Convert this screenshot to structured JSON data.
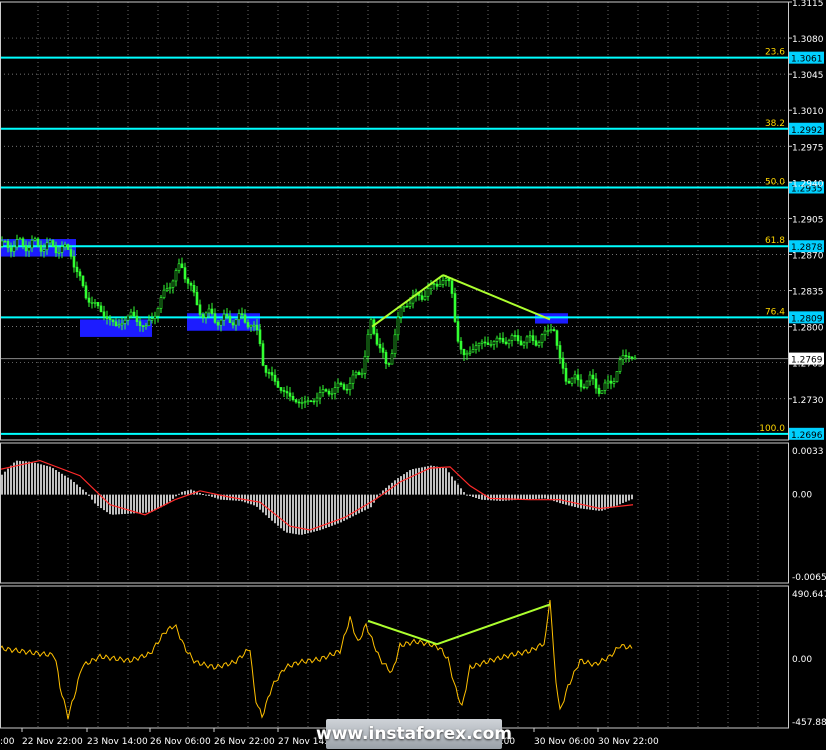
{
  "chart_data": [
    {
      "type": "candlestick",
      "panel": "price",
      "ylim": [
        1.269,
        1.3115
      ],
      "y_ticks": [
        "1.3115",
        "1.3080",
        "1.3045",
        "1.3010",
        "1.2975",
        "1.2940",
        "1.2905",
        "1.2870",
        "1.2835",
        "1.2800",
        "1.2765",
        "1.2730"
      ],
      "current_price": "1.2769",
      "fib_levels": [
        {
          "label": "23.6",
          "value": "1.3061"
        },
        {
          "label": "38.2",
          "value": "1.2992"
        },
        {
          "label": "50.0",
          "value": "1.2935"
        },
        {
          "label": "61.8",
          "value": "1.2878"
        },
        {
          "label": "76.4",
          "value": "1.2809"
        },
        {
          "label": "100.0",
          "value": "1.2696"
        }
      ],
      "zones": [
        {
          "from": 0,
          "to": 76,
          "price_top": 1.2885,
          "price_bottom": 1.2868
        },
        {
          "from": 80,
          "to": 152,
          "price_top": 1.2807,
          "price_bottom": 1.279
        },
        {
          "from": 187,
          "to": 260,
          "price_top": 1.2813,
          "price_bottom": 1.2796
        },
        {
          "from": 535,
          "to": 568,
          "price_top": 1.2813,
          "price_bottom": 1.2803
        }
      ],
      "price_path": [
        [
          0,
          1.2878
        ],
        [
          20,
          1.288
        ],
        [
          40,
          1.2879
        ],
        [
          60,
          1.2876
        ],
        [
          70,
          1.2872
        ],
        [
          75,
          1.2855
        ],
        [
          85,
          1.283
        ],
        [
          100,
          1.2815
        ],
        [
          115,
          1.28
        ],
        [
          130,
          1.2812
        ],
        [
          145,
          1.2798
        ],
        [
          160,
          1.2825
        ],
        [
          170,
          1.2845
        ],
        [
          180,
          1.2858
        ],
        [
          188,
          1.2845
        ],
        [
          195,
          1.282
        ],
        [
          205,
          1.2812
        ],
        [
          220,
          1.2806
        ],
        [
          240,
          1.2808
        ],
        [
          250,
          1.2803
        ],
        [
          258,
          1.279
        ],
        [
          263,
          1.276
        ],
        [
          275,
          1.2745
        ],
        [
          290,
          1.273
        ],
        [
          305,
          1.2725
        ],
        [
          320,
          1.2735
        ],
        [
          335,
          1.274
        ],
        [
          350,
          1.2745
        ],
        [
          362,
          1.2762
        ],
        [
          370,
          1.2802
        ],
        [
          378,
          1.2785
        ],
        [
          386,
          1.2755
        ],
        [
          395,
          1.28
        ],
        [
          405,
          1.2825
        ],
        [
          420,
          1.283
        ],
        [
          440,
          1.2845
        ],
        [
          450,
          1.2842
        ],
        [
          456,
          1.279
        ],
        [
          462,
          1.277
        ],
        [
          475,
          1.2782
        ],
        [
          490,
          1.2785
        ],
        [
          510,
          1.2788
        ],
        [
          530,
          1.2786
        ],
        [
          545,
          1.279
        ],
        [
          552,
          1.2808
        ],
        [
          558,
          1.2765
        ],
        [
          565,
          1.2752
        ],
        [
          578,
          1.2745
        ],
        [
          590,
          1.2748
        ],
        [
          600,
          1.2738
        ],
        [
          612,
          1.2748
        ],
        [
          620,
          1.2768
        ],
        [
          628,
          1.2773
        ],
        [
          634,
          1.2769
        ]
      ],
      "trendlines": [
        [
          [
            372,
            1.28
          ],
          [
            443,
            1.285
          ]
        ],
        [
          [
            443,
            1.285
          ],
          [
            550,
            1.2807
          ]
        ]
      ]
    },
    {
      "type": "histogram",
      "panel": "MACD",
      "ylim": [
        -0.00653,
        0.0033
      ],
      "y_ticks": [
        "0.0033",
        "0.00",
        "-0.00653"
      ],
      "hist_path": [
        [
          0,
          0.0015
        ],
        [
          15,
          0.0027
        ],
        [
          30,
          0.0026
        ],
        [
          50,
          0.0022
        ],
        [
          70,
          0.0012
        ],
        [
          85,
          0.0002
        ],
        [
          95,
          -0.0008
        ],
        [
          110,
          -0.0016
        ],
        [
          130,
          -0.0015
        ],
        [
          150,
          -0.0014
        ],
        [
          165,
          -0.0008
        ],
        [
          180,
          0.0002
        ],
        [
          190,
          0.0004
        ],
        [
          200,
          0.0001
        ],
        [
          220,
          -0.0004
        ],
        [
          240,
          -0.0005
        ],
        [
          255,
          -0.0009
        ],
        [
          270,
          -0.002
        ],
        [
          285,
          -0.003
        ],
        [
          300,
          -0.0032
        ],
        [
          320,
          -0.0028
        ],
        [
          340,
          -0.0022
        ],
        [
          355,
          -0.0016
        ],
        [
          370,
          -0.001
        ],
        [
          380,
          0.0002
        ],
        [
          395,
          0.0012
        ],
        [
          410,
          0.002
        ],
        [
          430,
          0.0023
        ],
        [
          445,
          0.0021
        ],
        [
          455,
          0.001
        ],
        [
          465,
          0.0
        ],
        [
          480,
          -0.0004
        ],
        [
          500,
          -0.0005
        ],
        [
          520,
          -0.0004
        ],
        [
          545,
          -0.0003
        ],
        [
          560,
          -0.0007
        ],
        [
          580,
          -0.0011
        ],
        [
          600,
          -0.0013
        ],
        [
          615,
          -0.0009
        ],
        [
          633,
          -0.0003
        ]
      ],
      "signal_path": [
        [
          0,
          0.002
        ],
        [
          40,
          0.0027
        ],
        [
          80,
          0.0015
        ],
        [
          110,
          -0.0008
        ],
        [
          145,
          -0.0016
        ],
        [
          175,
          -0.0004
        ],
        [
          200,
          0.0003
        ],
        [
          230,
          -0.0002
        ],
        [
          260,
          -0.0006
        ],
        [
          290,
          -0.0025
        ],
        [
          310,
          -0.0028
        ],
        [
          345,
          -0.0018
        ],
        [
          375,
          -0.0004
        ],
        [
          400,
          0.001
        ],
        [
          430,
          0.0021
        ],
        [
          450,
          0.0022
        ],
        [
          470,
          0.0007
        ],
        [
          490,
          -0.0003
        ],
        [
          530,
          -0.0004
        ],
        [
          560,
          -0.0004
        ],
        [
          600,
          -0.0011
        ],
        [
          633,
          -0.0008
        ]
      ]
    },
    {
      "type": "line",
      "panel": "CCI",
      "ylim": [
        -457.889,
        490.647
      ],
      "y_ticks": [
        "490.647",
        "0.00",
        "-457.889"
      ],
      "series_path": [
        [
          0,
          80
        ],
        [
          20,
          60
        ],
        [
          40,
          40
        ],
        [
          55,
          30
        ],
        [
          60,
          -200
        ],
        [
          68,
          -420
        ],
        [
          75,
          -250
        ],
        [
          82,
          -50
        ],
        [
          100,
          20
        ],
        [
          130,
          -10
        ],
        [
          150,
          40
        ],
        [
          165,
          200
        ],
        [
          175,
          250
        ],
        [
          185,
          80
        ],
        [
          195,
          -20
        ],
        [
          215,
          -60
        ],
        [
          235,
          -20
        ],
        [
          250,
          80
        ],
        [
          255,
          -280
        ],
        [
          262,
          -420
        ],
        [
          272,
          -200
        ],
        [
          285,
          -60
        ],
        [
          300,
          -20
        ],
        [
          320,
          0
        ],
        [
          340,
          60
        ],
        [
          350,
          300
        ],
        [
          358,
          120
        ],
        [
          366,
          250
        ],
        [
          380,
          0
        ],
        [
          392,
          -100
        ],
        [
          400,
          100
        ],
        [
          415,
          130
        ],
        [
          430,
          110
        ],
        [
          440,
          80
        ],
        [
          448,
          0
        ],
        [
          455,
          -200
        ],
        [
          462,
          -350
        ],
        [
          470,
          -60
        ],
        [
          490,
          -10
        ],
        [
          510,
          30
        ],
        [
          530,
          60
        ],
        [
          545,
          120
        ],
        [
          550,
          450
        ],
        [
          555,
          -100
        ],
        [
          560,
          -380
        ],
        [
          568,
          -200
        ],
        [
          580,
          -10
        ],
        [
          595,
          -40
        ],
        [
          610,
          20
        ],
        [
          620,
          100
        ],
        [
          633,
          80
        ]
      ],
      "trendlines": [
        [
          [
            368,
            280
          ],
          [
            437,
            110
          ]
        ],
        [
          [
            437,
            110
          ],
          [
            550,
            400
          ]
        ]
      ]
    }
  ],
  "x_ticks": [
    "22 Nov 22:00",
    "23 Nov 14:00",
    "26 Nov 06:00",
    "26 Nov 22:00",
    "27 Nov 14:00",
    "30 Nov 06:00",
    "30 Nov 22:00"
  ],
  "x_edge_labels": [
    ":00",
    "v 14:00"
  ],
  "watermark": "www.instaforex.com",
  "colors": {
    "background": "#000000",
    "grid": "#9a9a9a",
    "fib_line": "#00ffff",
    "label_box": "#00d0ff",
    "zone": "#1c1cff",
    "candles": "#33ff33",
    "trendline": "#adff2f",
    "macd_hist": "#c0c0c0",
    "macd_signal": "#ff2a2a",
    "cci": "#ffc000",
    "axis_text": "#ffffff",
    "fib_text": "#ffd700"
  }
}
